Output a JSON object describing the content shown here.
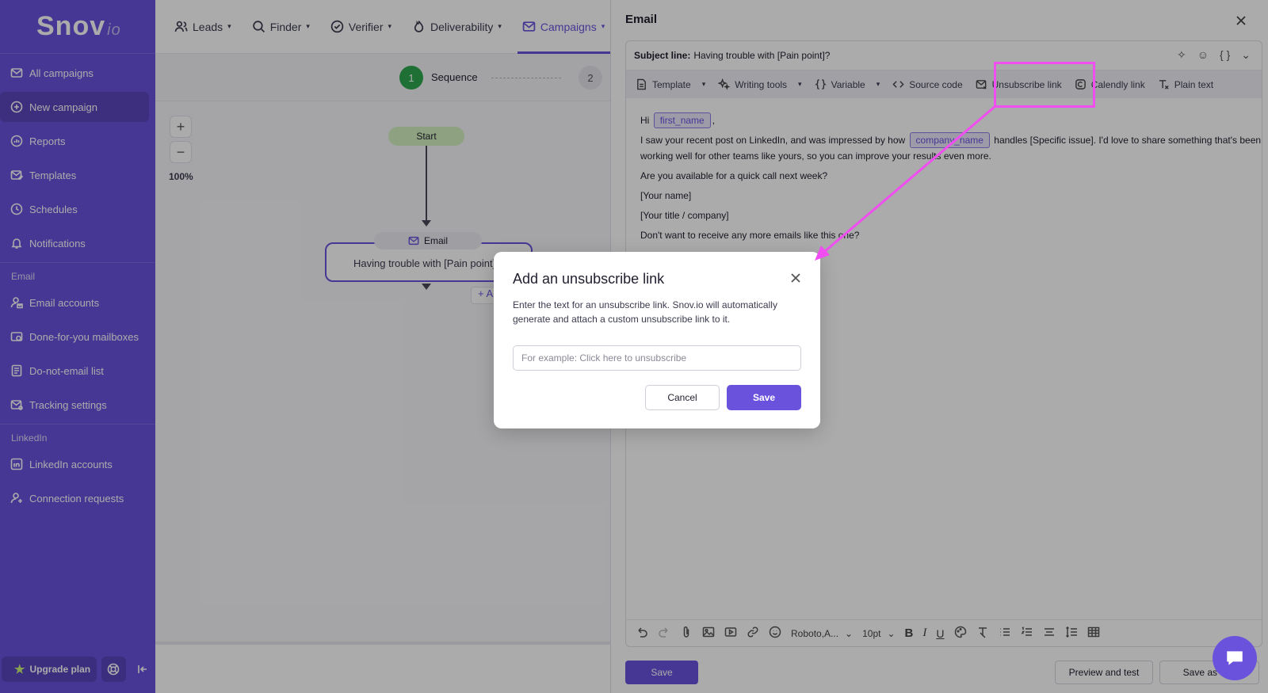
{
  "app": {
    "logo_text": "Snov",
    "logo_suffix": "io"
  },
  "sidebar": {
    "items": [
      {
        "label": "All campaigns",
        "icon": "mail-icon"
      },
      {
        "label": "New campaign",
        "icon": "plus-circle-icon",
        "active": true
      },
      {
        "label": "Reports",
        "icon": "chart-icon"
      },
      {
        "label": "Templates",
        "icon": "mail-edit-icon"
      },
      {
        "label": "Schedules",
        "icon": "clock-icon"
      },
      {
        "label": "Notifications",
        "icon": "bell-icon"
      }
    ],
    "section_email": "Email",
    "email_items": [
      {
        "label": "Email accounts",
        "icon": "user-mail-icon"
      },
      {
        "label": "Done-for-you mailboxes",
        "icon": "mailbox-icon"
      },
      {
        "label": "Do-not-email list",
        "icon": "list-icon"
      },
      {
        "label": "Tracking settings",
        "icon": "mail-settings-icon"
      }
    ],
    "section_linkedin": "LinkedIn",
    "linkedin_items": [
      {
        "label": "LinkedIn accounts",
        "icon": "linkedin-icon"
      },
      {
        "label": "Connection requests",
        "icon": "user-plus-icon"
      }
    ],
    "upgrade_label": "Upgrade plan"
  },
  "topnav": {
    "items": [
      {
        "label": "Leads"
      },
      {
        "label": "Finder"
      },
      {
        "label": "Verifier"
      },
      {
        "label": "Deliverability"
      },
      {
        "label": "Campaigns",
        "active": true
      }
    ]
  },
  "sequence": {
    "step1_number": "1",
    "step1_label": "Sequence",
    "step2_number": "2",
    "zoom_level": "100%",
    "start_label": "Start",
    "email_node_label": "Email",
    "email_node_subject": "Having trouble with [Pain point]?",
    "add_label": "+ A"
  },
  "email_panel": {
    "title": "Email",
    "subject_label": "Subject line:",
    "subject_value": "Having trouble with [Pain point]?",
    "toolbar": {
      "template": "Template",
      "writing_tools": "Writing tools",
      "variable": "Variable",
      "source_code": "Source code",
      "unsubscribe_link": "Unsubscribe link",
      "calendly_link": "Calendly link",
      "plain_text": "Plain text"
    },
    "body": {
      "greeting": "Hi",
      "var_first_name": "first_name",
      "greeting_end": ",",
      "line1_start": "I saw your recent post on LinkedIn, and was impressed by how",
      "var_company_name": "company_name",
      "line1_end": "handles [Specific issue]. I'd love to share something that's been working well for other teams like yours, so you can improve your results even more.",
      "line2": "Are you available for a quick call next week?",
      "line3": "[Your name]",
      "line4": "[Your title / company]",
      "line5": "Don't want to receive any more emails like this one?"
    },
    "font_name": "Roboto,A...",
    "font_size": "10pt",
    "save_label": "Save",
    "preview_label": "Preview and test",
    "save_template_label": "Save as te..."
  },
  "modal": {
    "title": "Add an unsubscribe link",
    "description": "Enter the text for an unsubscribe link. Snov.io will automatically generate and attach a custom unsubscribe link to it.",
    "input_placeholder": "For example: Click here to unsubscribe",
    "input_value": "",
    "cancel_label": "Cancel",
    "save_label": "Save"
  },
  "colors": {
    "brand": "#6a52dd",
    "annotation": "#f04ef0",
    "step_done": "#2fa84f"
  }
}
